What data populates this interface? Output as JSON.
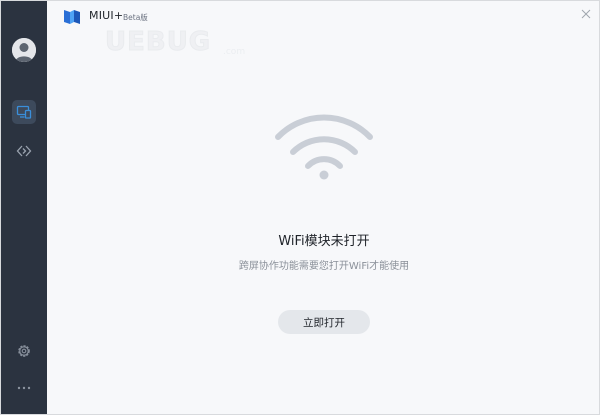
{
  "app": {
    "title": "MIUI+",
    "badge": "Beta版"
  },
  "watermark": {
    "big": "UEBUG",
    "small": ".com"
  },
  "main": {
    "title": "WiFi模块未打开",
    "subtitle": "跨屏协作功能需要您打开WiFi才能使用",
    "button_label": "立即打开"
  },
  "sidebar": {
    "items": [
      {
        "icon": "avatar-icon"
      },
      {
        "icon": "devices-icon",
        "active": true
      },
      {
        "icon": "connect-icon"
      },
      {
        "icon": "gear-icon"
      },
      {
        "icon": "more-icon"
      }
    ]
  },
  "colors": {
    "sidebar_bg": "#2b3340",
    "accent": "#3a8fdb",
    "wifi": "#c9ced6",
    "button_bg": "#e4e7eb",
    "content_bg": "#f7f8fa"
  }
}
